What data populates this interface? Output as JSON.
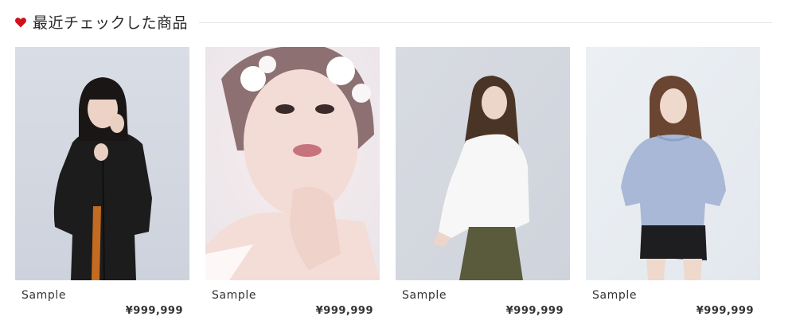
{
  "section": {
    "title": "最近チェックした商品",
    "accent_color": "#d0111b",
    "icon": "heart-icon"
  },
  "products": [
    {
      "name": "Sample",
      "price": "¥999,999",
      "image": "woman-black-coat-photo"
    },
    {
      "name": "Sample",
      "price": "¥999,999",
      "image": "woman-floral-beauty-photo"
    },
    {
      "name": "Sample",
      "price": "¥999,999",
      "image": "woman-white-blouse-photo"
    },
    {
      "name": "Sample",
      "price": "¥999,999",
      "image": "woman-blue-sweater-photo"
    }
  ]
}
